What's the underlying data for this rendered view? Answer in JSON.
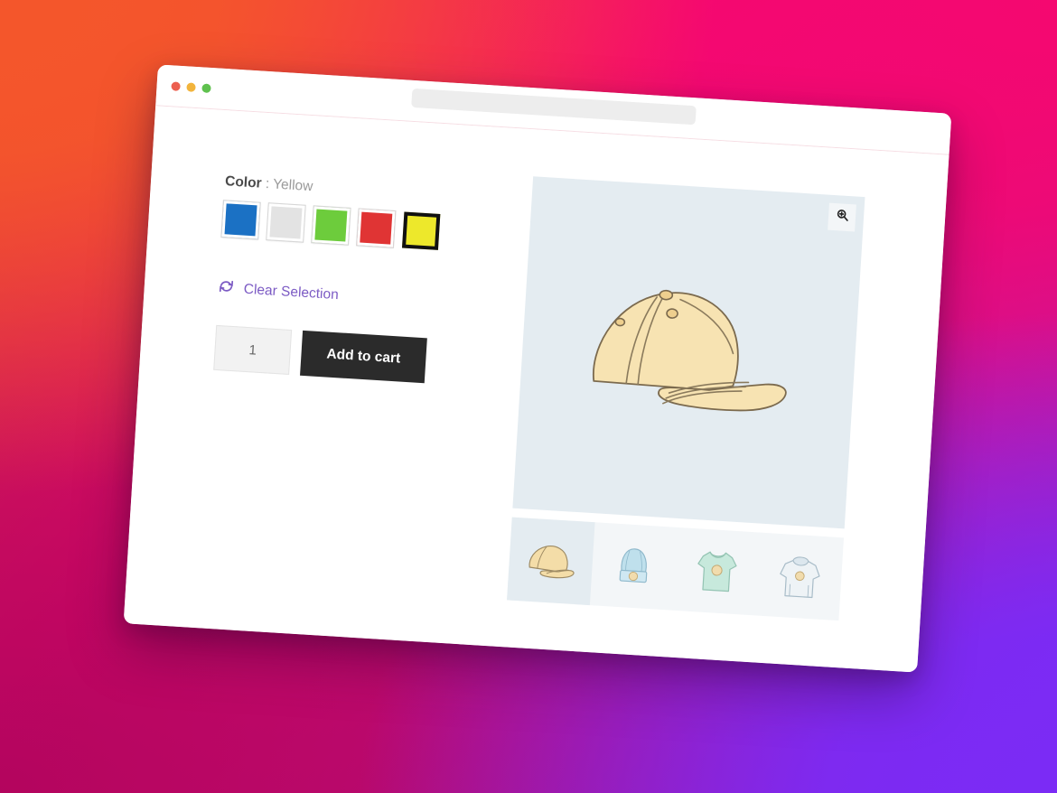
{
  "window": {
    "traffic_lights": [
      {
        "name": "close",
        "color": "#ec5f4f"
      },
      {
        "name": "minimize",
        "color": "#f2b43c"
      },
      {
        "name": "maximize",
        "color": "#5fc14e"
      }
    ],
    "address_bar": {
      "value": "",
      "placeholder": ""
    }
  },
  "background": {
    "top_left": "#f4562b",
    "top_right": "#f50870",
    "bottom_left": "#b3055e",
    "bottom_right": "#7b2bf5"
  },
  "product": {
    "color_option": {
      "label": "Color",
      "separator": " : ",
      "selected_value": "Yellow",
      "swatches": [
        {
          "name": "Blue",
          "hex": "#1b71c4",
          "selected": false
        },
        {
          "name": "White",
          "hex": "#e3e3e3",
          "selected": false
        },
        {
          "name": "Green",
          "hex": "#6dcc3c",
          "selected": false
        },
        {
          "name": "Red",
          "hex": "#e03434",
          "selected": false
        },
        {
          "name": "Yellow",
          "hex": "#ede82b",
          "selected": true
        }
      ]
    },
    "clear_selection": {
      "label": "Clear Selection",
      "icon": "refresh-icon",
      "color": "#7c5bc4"
    },
    "quantity": {
      "value": "1",
      "placeholder": ""
    },
    "add_to_cart": {
      "label": "Add to cart",
      "background": "#2b2b2b",
      "text_color": "#ffffff"
    }
  },
  "gallery": {
    "zoom_button": {
      "icon": "zoom-in-icon"
    },
    "hero": {
      "alt": "yellow baseball cap",
      "background": "#e4ecf1"
    },
    "thumbnails": [
      {
        "name": "yellow-cap",
        "alt": "Yellow baseball cap",
        "active": true
      },
      {
        "name": "blue-beanie",
        "alt": "Blue beanie hat",
        "active": false
      },
      {
        "name": "mint-tshirt",
        "alt": "Mint green t-shirt",
        "active": false
      },
      {
        "name": "gray-hoodie",
        "alt": "Gray hoodie",
        "active": false
      }
    ]
  }
}
